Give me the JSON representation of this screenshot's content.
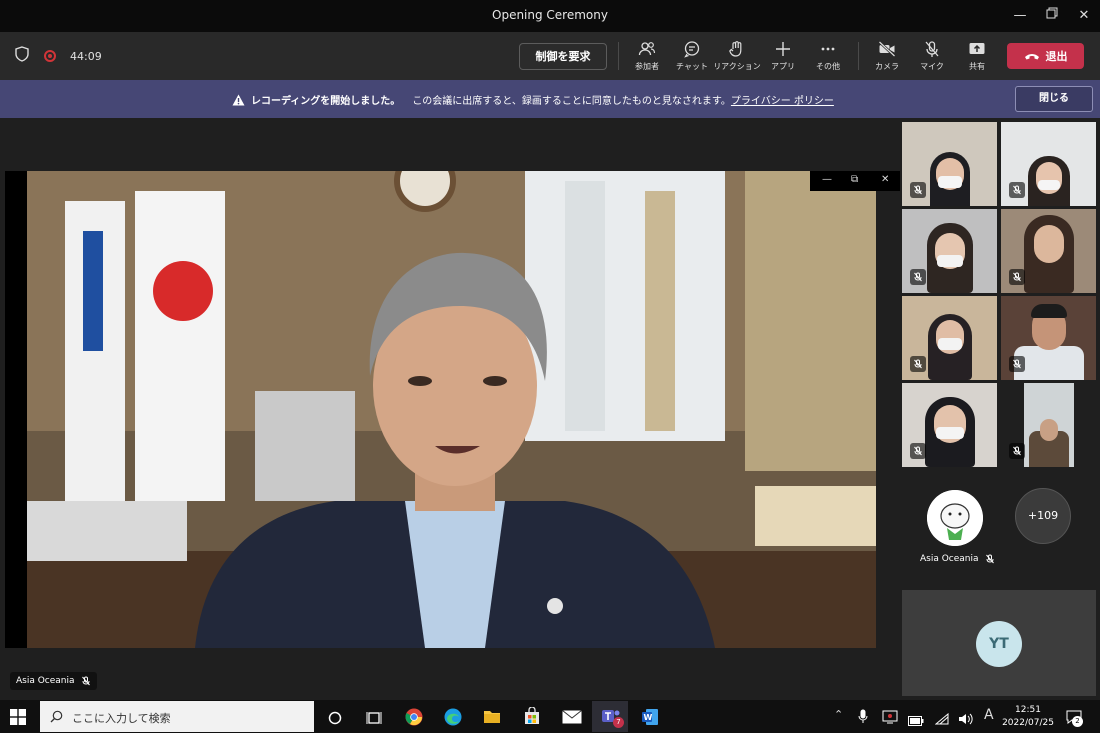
{
  "window": {
    "title": "Opening Ceremony"
  },
  "toolbar": {
    "timer": "44:09",
    "request_control": "制御を要求",
    "items": [
      {
        "label": "参加者",
        "icon": "people-icon"
      },
      {
        "label": "チャット",
        "icon": "chat-icon"
      },
      {
        "label": "リアクション",
        "icon": "reaction-icon"
      },
      {
        "label": "アプリ",
        "icon": "plus-icon"
      },
      {
        "label": "その他",
        "icon": "more-icon"
      },
      {
        "label": "カメラ",
        "icon": "camera-off-icon"
      },
      {
        "label": "マイク",
        "icon": "mic-off-icon"
      },
      {
        "label": "共有",
        "icon": "share-icon"
      }
    ],
    "leave": "退出",
    "colors": {
      "leave": "#c4314b",
      "record": "#d13438"
    }
  },
  "banner": {
    "bold": "レコーディングを開始しました。",
    "text": "この会議に出席すると、録画することに同意したものと見なされます。",
    "link": "プライバシー ポリシー",
    "close": "閉じる",
    "color": "#464775"
  },
  "stage": {
    "speaker_name": "Asia Oceania"
  },
  "participants": {
    "avatar_name": "Asia Oceania",
    "overflow": "+109",
    "initials": "YT"
  },
  "taskbar": {
    "search_placeholder": "ここに入力して検索",
    "ime": "A",
    "time": "12:51",
    "date": "2022/07/25",
    "teams_badge": "7",
    "notif_badge": "2"
  }
}
